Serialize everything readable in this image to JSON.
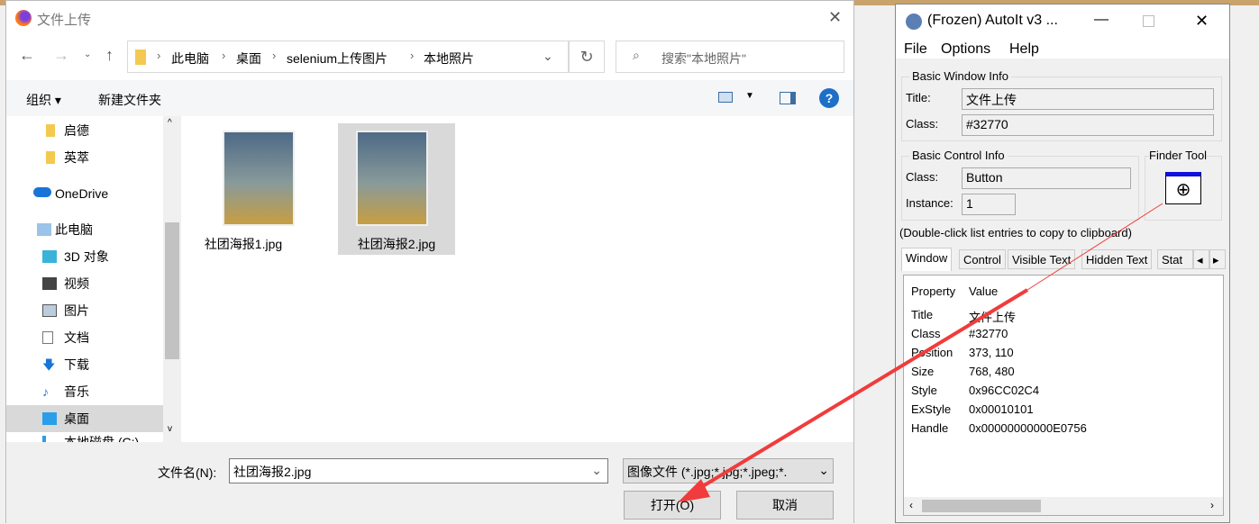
{
  "dialog": {
    "title": "文件上传",
    "breadcrumb": [
      "此电脑",
      "桌面",
      "selenium上传图片",
      "本地照片"
    ],
    "search_placeholder": "搜索\"本地照片\"",
    "organize": "组织 ▾",
    "new_folder": "新建文件夹",
    "nav": [
      {
        "label": "启德",
        "icon": "folder-icon"
      },
      {
        "label": "英萃",
        "icon": "folder-icon"
      },
      {
        "label": "OneDrive",
        "icon": "cloud-icon"
      },
      {
        "label": "此电脑",
        "icon": "computer-icon"
      },
      {
        "label": "3D 对象",
        "icon": "cube-icon"
      },
      {
        "label": "视频",
        "icon": "video-icon"
      },
      {
        "label": "图片",
        "icon": "picture-icon"
      },
      {
        "label": "文档",
        "icon": "document-icon"
      },
      {
        "label": "下载",
        "icon": "download-icon"
      },
      {
        "label": "音乐",
        "icon": "music-icon"
      },
      {
        "label": "桌面",
        "icon": "desktop-icon",
        "selected": true
      },
      {
        "label": "本地磁盘 (C:)",
        "icon": "drive-icon"
      }
    ],
    "files": [
      {
        "name": "社团海报1.jpg"
      },
      {
        "name": "社团海报2.jpg",
        "selected": true
      }
    ],
    "filename_label": "文件名(N):",
    "filename_value": "社团海报2.jpg",
    "filter": "图像文件 (*.jpg;*.jpg;*.jpeg;*.",
    "open": "打开(O)",
    "cancel": "取消"
  },
  "autoit": {
    "title": "(Frozen) AutoIt v3 ...",
    "menu": [
      "File",
      "Options",
      "Help"
    ],
    "basic_window": {
      "heading": "Basic Window Info",
      "title_label": "Title:",
      "title_value": "文件上传",
      "class_label": "Class:",
      "class_value": "#32770"
    },
    "basic_control": {
      "heading": "Basic Control Info",
      "class_label": "Class:",
      "class_value": "Button",
      "instance_label": "Instance:",
      "instance_value": "1"
    },
    "finder": "Finder Tool",
    "hint": "(Double-click list entries to copy to clipboard)",
    "tabs": [
      "Window",
      "Control",
      "Visible Text",
      "Hidden Text",
      "Stat"
    ],
    "columns": [
      "Property",
      "Value"
    ],
    "rows": [
      [
        "Title",
        "文件上传"
      ],
      [
        "Class",
        "#32770"
      ],
      [
        "Position",
        "373, 110"
      ],
      [
        "Size",
        "768, 480"
      ],
      [
        "Style",
        "0x96CC02C4"
      ],
      [
        "ExStyle",
        "0x00010101"
      ],
      [
        "Handle",
        "0x00000000000E0756"
      ]
    ]
  },
  "annotation_color": "#f03c3c"
}
